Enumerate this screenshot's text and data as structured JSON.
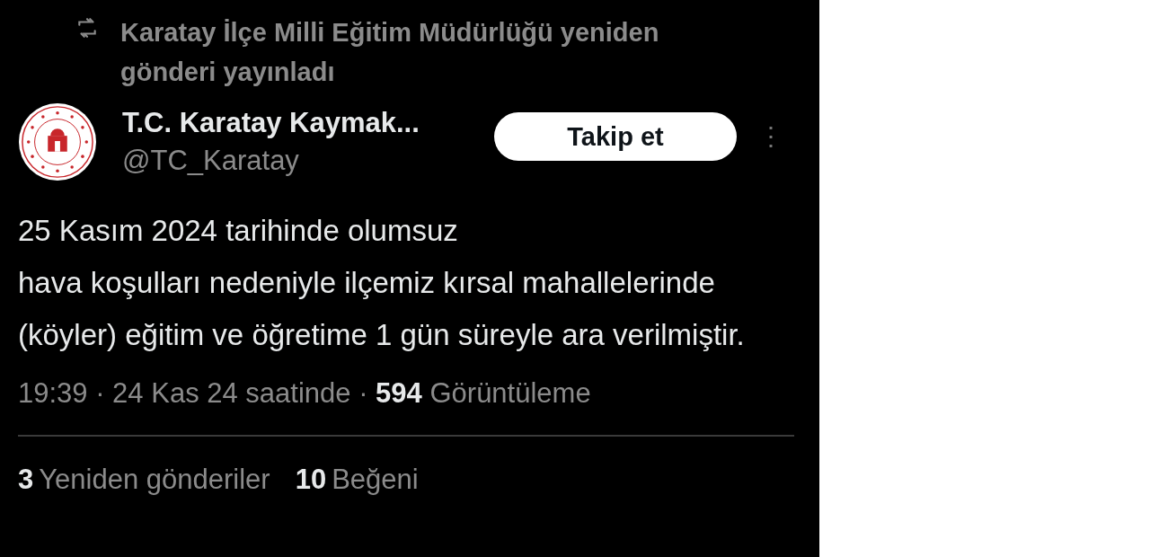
{
  "repost_banner": {
    "text": "Karatay İlçe Milli Eğitim Müdürlüğü yeniden gönderi yayınladı"
  },
  "author": {
    "name": "T.C. Karatay Kaymak...",
    "handle": "@TC_Karatay"
  },
  "follow_button": {
    "label": "Takip et"
  },
  "more_button": {
    "label": "⋮"
  },
  "post": {
    "text": "25 Kasım 2024 tarihinde olumsuz\nhava koşulları nedeniyle ilçemiz kırsal mahallelerinde (köyler) eğitim ve öğretime 1 gün süreyle ara verilmiştir.",
    "meta": "19:39 · 24 Kas 24 saatinde · **594** Görüntüleme"
  },
  "stats": [
    {
      "count": "3",
      "label": "Yeniden gönderiler"
    },
    {
      "count": "10",
      "label": "Beğeni"
    }
  ]
}
